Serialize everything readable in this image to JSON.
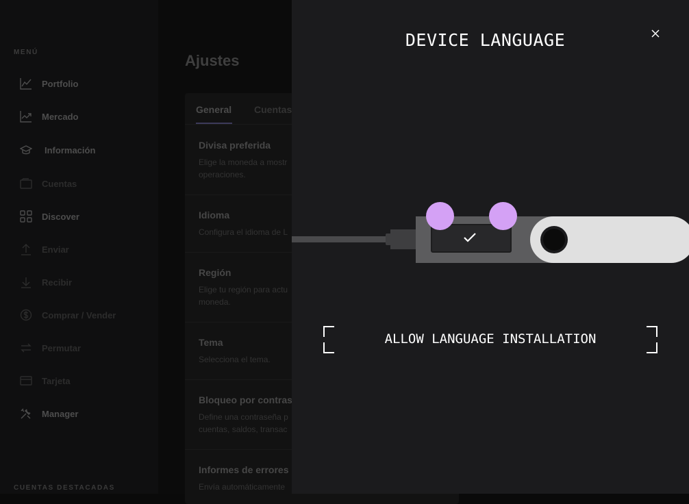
{
  "sidebar": {
    "menu_title": "MENÚ",
    "items": [
      {
        "label": "Portfolio",
        "icon": "chart-line-icon"
      },
      {
        "label": "Mercado",
        "icon": "trend-icon"
      },
      {
        "label": "Información",
        "icon": "graduation-cap-icon"
      },
      {
        "label": "Cuentas",
        "icon": "wallet-icon"
      },
      {
        "label": "Discover",
        "icon": "grid-icon"
      },
      {
        "label": "Enviar",
        "icon": "arrow-up-icon"
      },
      {
        "label": "Recibir",
        "icon": "arrow-down-icon"
      },
      {
        "label": "Comprar / Vender",
        "icon": "dollar-icon"
      },
      {
        "label": "Permutar",
        "icon": "swap-icon"
      },
      {
        "label": "Tarjeta",
        "icon": "card-icon"
      },
      {
        "label": "Manager",
        "icon": "tools-icon"
      }
    ],
    "featured_title": "CUENTAS DESTACADAS"
  },
  "main": {
    "title": "Ajustes",
    "tabs": [
      {
        "label": "General"
      },
      {
        "label": "Cuentas"
      }
    ],
    "settings": [
      {
        "title": "Divisa preferida",
        "desc": "Elige la moneda a mostr\noperaciones."
      },
      {
        "title": "Idioma",
        "desc": "Configura el idioma de L"
      },
      {
        "title": "Región",
        "desc": "Elige tu región para actu\nmoneda."
      },
      {
        "title": "Tema",
        "desc": "Selecciona el tema."
      },
      {
        "title": "Bloqueo por contras",
        "desc": "Define una contraseña p\ncuentas, saldos, transac"
      },
      {
        "title": "Informes de errores",
        "desc": "Envía automáticamente"
      }
    ]
  },
  "modal": {
    "title": "DEVICE LANGUAGE",
    "instruction": "ALLOW LANGUAGE INSTALLATION",
    "device_screen_icon": "check-icon",
    "button_highlight_color": "#d4a1f5"
  },
  "colors": {
    "panel_bg": "#1b1b1d",
    "accent": "#d4a1f5"
  }
}
